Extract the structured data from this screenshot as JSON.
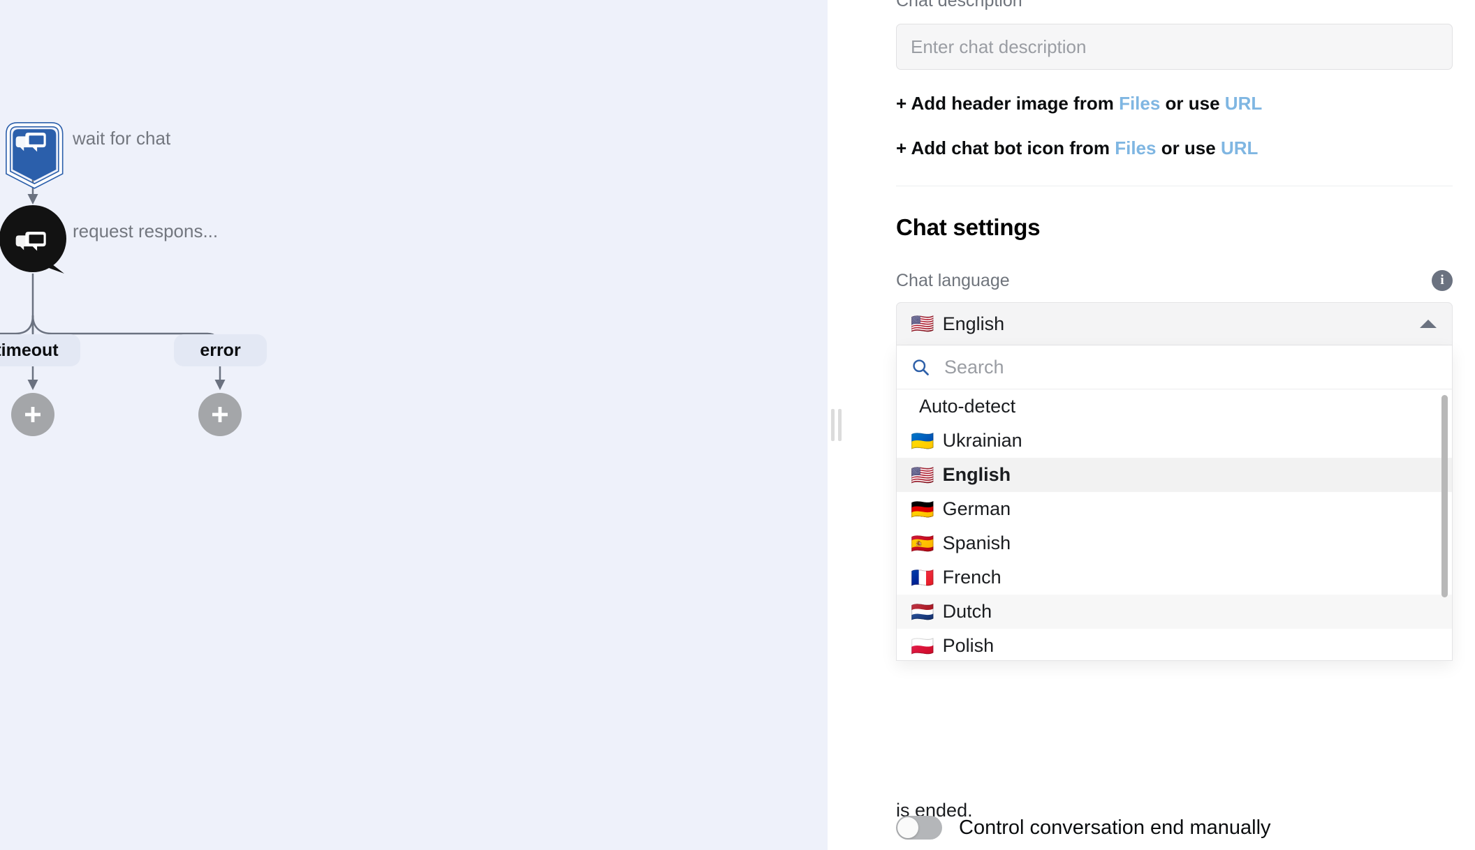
{
  "canvas": {
    "background_color": "#eef1fa",
    "nodes": [
      {
        "id": "trigger",
        "label": "wait for chat",
        "icon": "chat-bubbles-icon",
        "shape": "shield",
        "color": "#2b5fab"
      },
      {
        "id": "request",
        "label": "request respons...",
        "icon": "chat-bubbles-icon",
        "shape": "speech-circle",
        "color": "#121212"
      }
    ],
    "branches": [
      {
        "id": "timeout",
        "label": "timeout"
      },
      {
        "id": "error",
        "label": "error"
      }
    ],
    "add_buttons": [
      {
        "id": "add-after-timeout",
        "icon": "plus-icon"
      },
      {
        "id": "add-after-error",
        "icon": "plus-icon"
      }
    ],
    "pill_color": "#e3e8f4",
    "edge_color": "#6b7280"
  },
  "splitter": {
    "icon": "drag-handle-icon"
  },
  "panel": {
    "description": {
      "label": "Chat description",
      "value": "",
      "placeholder": "Enter chat description"
    },
    "add_header_image": {
      "prefix": "+ Add header image from ",
      "files_label": "Files",
      "middle": " or use ",
      "url_label": "URL"
    },
    "add_chat_bot_icon": {
      "prefix": "+ Add chat bot icon from ",
      "files_label": "Files",
      "middle": " or use ",
      "url_label": "URL"
    },
    "section_title": "Chat settings",
    "chat_language": {
      "label": "Chat language",
      "info_icon": "info-icon",
      "selected_flag": "🇺🇸",
      "selected_label": "English",
      "caret": "caret-up-icon",
      "dropdown_open": true,
      "search": {
        "icon": "search-icon",
        "value": "",
        "placeholder": "Search"
      },
      "options": [
        {
          "flag": "",
          "label": "Auto-detect",
          "state": "normal"
        },
        {
          "flag": "🇺🇦",
          "label": "Ukrainian",
          "state": "normal"
        },
        {
          "flag": "🇺🇸",
          "label": "English",
          "state": "selected"
        },
        {
          "flag": "🇩🇪",
          "label": "German",
          "state": "normal"
        },
        {
          "flag": "🇪🇸",
          "label": "Spanish",
          "state": "normal"
        },
        {
          "flag": "🇫🇷",
          "label": "French",
          "state": "normal"
        },
        {
          "flag": "🇳🇱",
          "label": "Dutch",
          "state": "hovered"
        },
        {
          "flag": "🇵🇱",
          "label": "Polish",
          "state": "normal"
        }
      ]
    },
    "occluded_text": "is ended.",
    "control_conversation_end": {
      "label": "Control conversation end manually",
      "enabled": false
    },
    "link_color": "#7fb6e2",
    "accent_color": "#2b5fab"
  }
}
